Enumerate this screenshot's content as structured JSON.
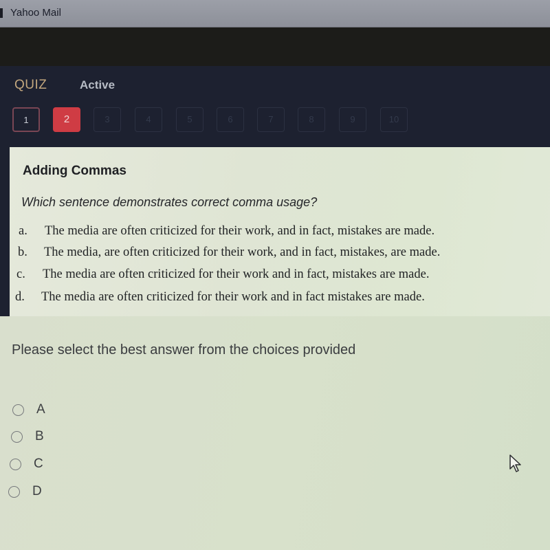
{
  "browser": {
    "tab_title": "Yahoo Mail"
  },
  "quiz": {
    "label": "QUIZ",
    "status": "Active",
    "questions": [
      {
        "number": "1",
        "state": "done"
      },
      {
        "number": "2",
        "state": "current"
      },
      {
        "number": "3",
        "state": "pending"
      },
      {
        "number": "4",
        "state": "pending"
      },
      {
        "number": "5",
        "state": "pending"
      },
      {
        "number": "6",
        "state": "pending"
      },
      {
        "number": "7",
        "state": "pending"
      },
      {
        "number": "8",
        "state": "pending"
      },
      {
        "number": "9",
        "state": "pending"
      },
      {
        "number": "10",
        "state": "pending"
      }
    ],
    "current_color": "#cf3c44"
  },
  "question": {
    "title": "Adding Commas",
    "prompt": "Which sentence demonstrates correct comma usage?",
    "choices": [
      {
        "letter": "a.",
        "text": "The media are often criticized for their work, and in fact, mistakes are made."
      },
      {
        "letter": "b.",
        "text": "The media, are often criticized for their work, and in fact, mistakes, are made."
      },
      {
        "letter": "c.",
        "text": "The media are often criticized for their work and in fact, mistakes are made."
      },
      {
        "letter": "d.",
        "text": "The media are often criticized for their work and in fact mistakes are made."
      }
    ],
    "instructions": "Please select the best answer from the choices provided",
    "options": [
      {
        "label": "A",
        "selected": false
      },
      {
        "label": "B",
        "selected": false
      },
      {
        "label": "C",
        "selected": false
      },
      {
        "label": "D",
        "selected": false
      }
    ]
  },
  "icons": {
    "tab": "yahoo-mail-tab-icon",
    "cursor": "mouse-pointer-icon",
    "radio": "radio-button-icon"
  }
}
